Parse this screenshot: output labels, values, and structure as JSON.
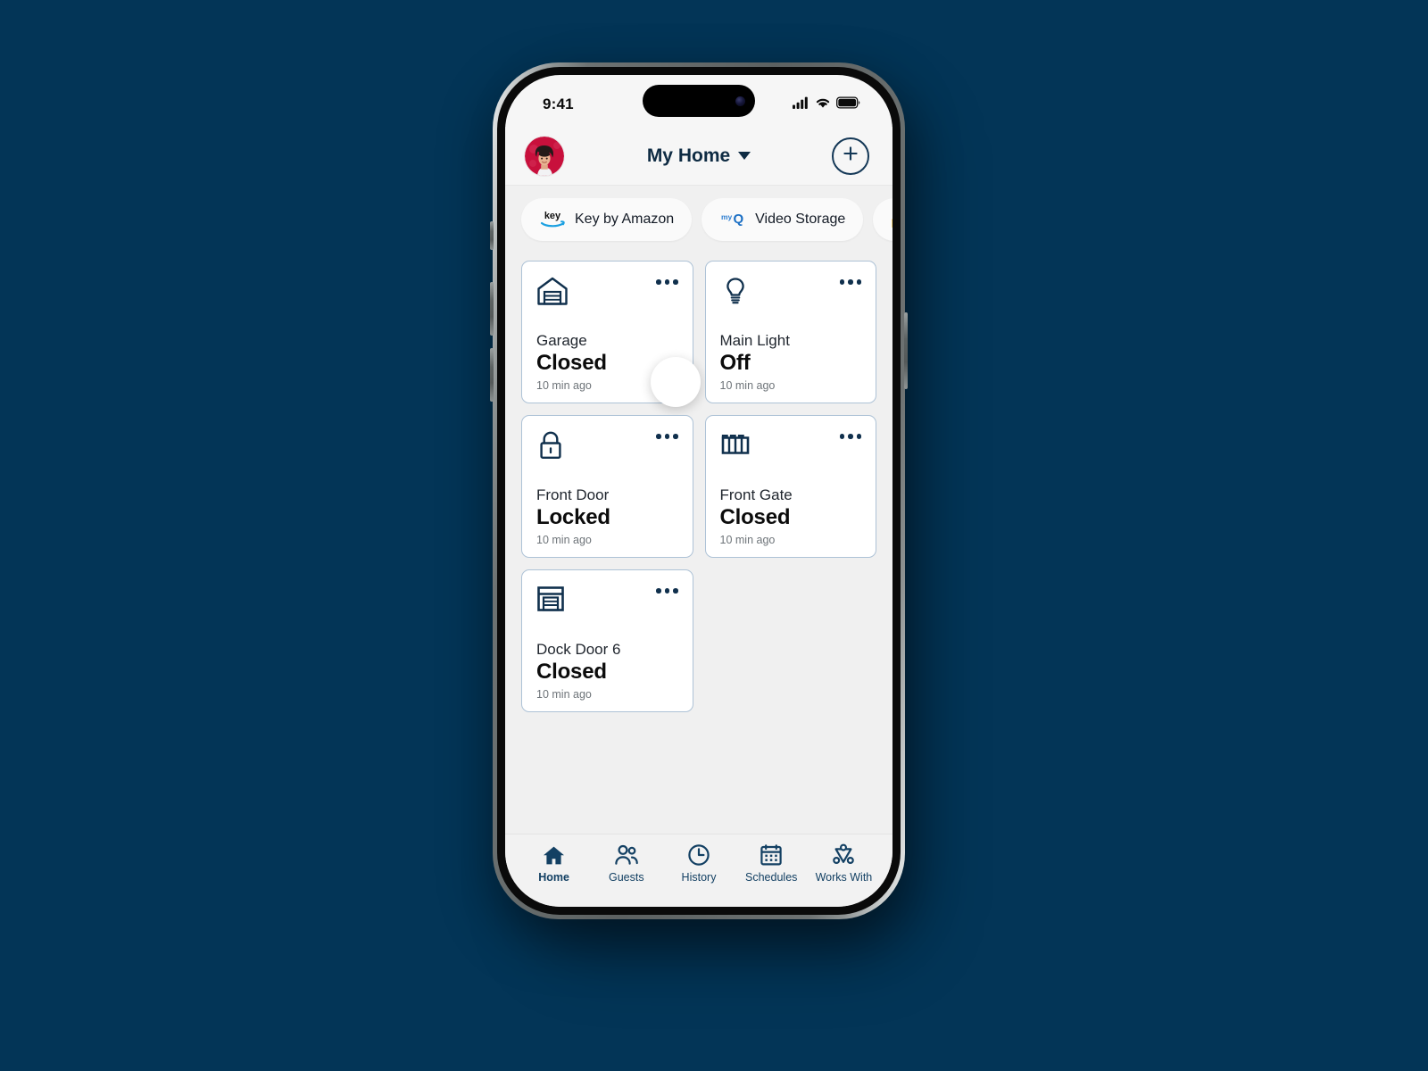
{
  "background_color": "#033557",
  "status_bar": {
    "time": "9:41",
    "signal_icon": "cellular-signal-icon",
    "wifi_icon": "wifi-icon",
    "battery_icon": "battery-icon"
  },
  "header": {
    "avatar_name": "user-avatar",
    "title": "My Home",
    "dropdown_icon": "chevron-down-icon",
    "add_button_icon": "plus-icon"
  },
  "chips": [
    {
      "label": "Key by Amazon",
      "icon": "amazon-key-icon"
    },
    {
      "label": "Video Storage",
      "icon": "myq-icon"
    },
    {
      "label": "",
      "icon": "google-home-icon"
    }
  ],
  "devices": [
    {
      "name": "Garage",
      "state": "Closed",
      "time": "10 min ago",
      "icon": "garage-door-icon",
      "menu_icon": "more-options-icon",
      "touch_indicator": true
    },
    {
      "name": "Main Light",
      "state": "Off",
      "time": "10 min ago",
      "icon": "light-bulb-icon",
      "menu_icon": "more-options-icon",
      "touch_indicator": false
    },
    {
      "name": "Front Door",
      "state": "Locked",
      "time": "10 min ago",
      "icon": "padlock-icon",
      "menu_icon": "more-options-icon",
      "touch_indicator": false
    },
    {
      "name": "Front Gate",
      "state": "Closed",
      "time": "10 min ago",
      "icon": "gate-icon",
      "menu_icon": "more-options-icon",
      "touch_indicator": false
    },
    {
      "name": "Dock Door 6",
      "state": "Closed",
      "time": "10 min ago",
      "icon": "dock-door-icon",
      "menu_icon": "more-options-icon",
      "touch_indicator": false
    }
  ],
  "bottom_nav": [
    {
      "label": "Home",
      "icon": "home-icon",
      "active": true
    },
    {
      "label": "Guests",
      "icon": "people-icon",
      "active": false
    },
    {
      "label": "History",
      "icon": "clock-icon",
      "active": false
    },
    {
      "label": "Schedules",
      "icon": "calendar-icon",
      "active": false
    },
    {
      "label": "Works With",
      "icon": "integrations-icon",
      "active": false
    }
  ],
  "colors": {
    "accent_navy": "#134063",
    "card_border": "#adc2d6",
    "app_bg": "#f0f0f0"
  }
}
